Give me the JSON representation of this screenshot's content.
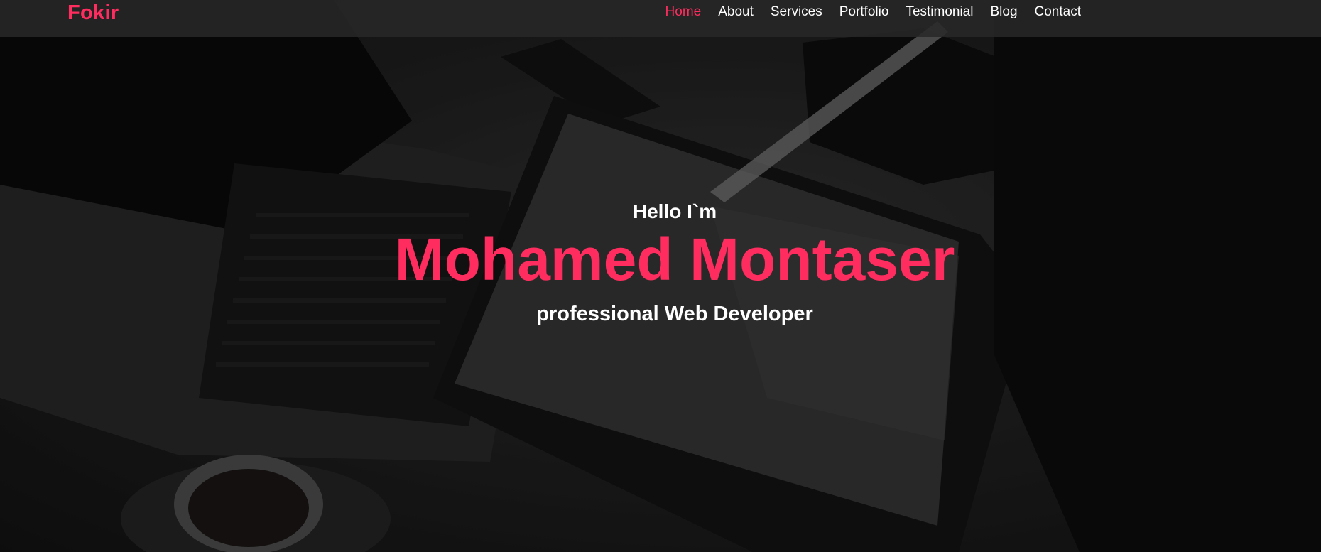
{
  "brand": "Fokir",
  "nav": {
    "items": [
      {
        "label": "Home",
        "active": true
      },
      {
        "label": "About",
        "active": false
      },
      {
        "label": "Services",
        "active": false
      },
      {
        "label": "Portfolio",
        "active": false
      },
      {
        "label": "Testimonial",
        "active": false
      },
      {
        "label": "Blog",
        "active": false
      },
      {
        "label": "Contact",
        "active": false
      }
    ]
  },
  "hero": {
    "greeting": "Hello I`m",
    "name": "Mohamed Montaser",
    "role": "professional Web Developer"
  },
  "colors": {
    "accent": "#ff2d5f",
    "text": "#ffffff",
    "navbar": "#282828"
  }
}
